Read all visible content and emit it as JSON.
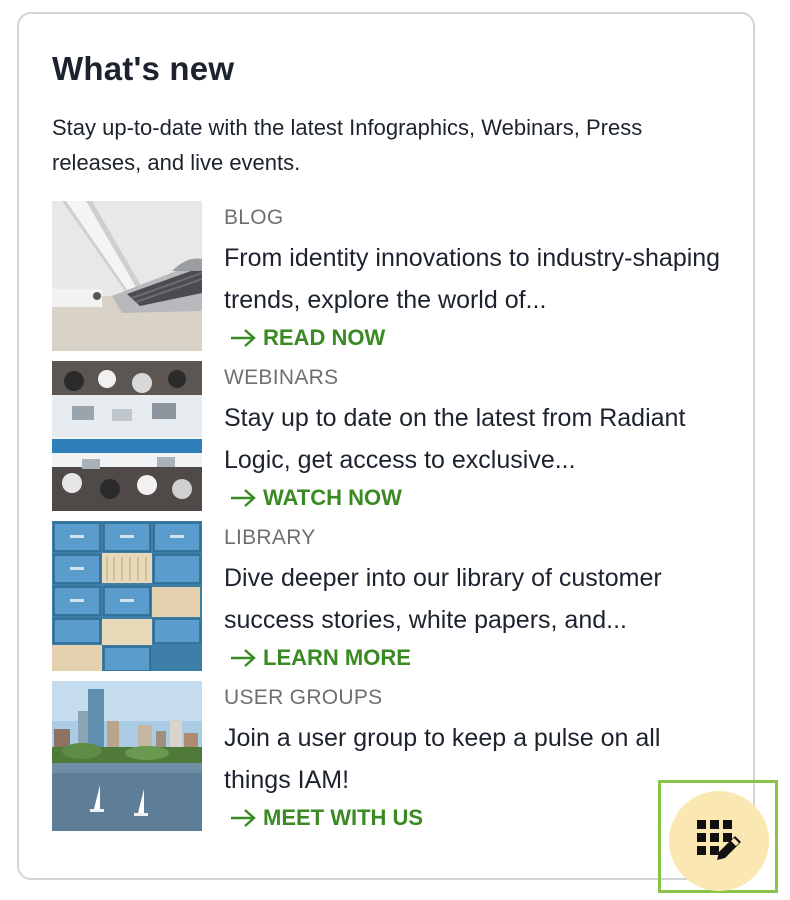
{
  "card": {
    "title": "What's new",
    "intro": "Stay up-to-date with the latest Infographics, Webinars, Press releases, and live events."
  },
  "items": [
    {
      "category": "BLOG",
      "description": "From identity innovations to industry-shaping trends, explore the world of...",
      "cta": "READ NOW",
      "image": "laptop-photo"
    },
    {
      "category": "WEBINARS",
      "description": "Stay up to date on the latest from Radiant Logic, get access to exclusive...",
      "cta": "WATCH NOW",
      "image": "meeting-overhead-photo"
    },
    {
      "category": "LIBRARY",
      "description": "Dive deeper into our library of customer success stories, white papers, and...",
      "cta": "LEARN MORE",
      "image": "file-cabinets-photo"
    },
    {
      "category": "USER GROUPS",
      "description": "Join a user group to keep a pulse on all things IAM!",
      "cta": "MEET WITH US",
      "image": "city-skyline-photo"
    }
  ],
  "colors": {
    "accent_green": "#3a8a23",
    "fab_background": "#fbe7b1",
    "highlight_border": "#8bc34a",
    "category_gray": "#6f6f6f",
    "text_dark": "#1d232e"
  },
  "fab": {
    "icon": "edit-grid-icon"
  }
}
